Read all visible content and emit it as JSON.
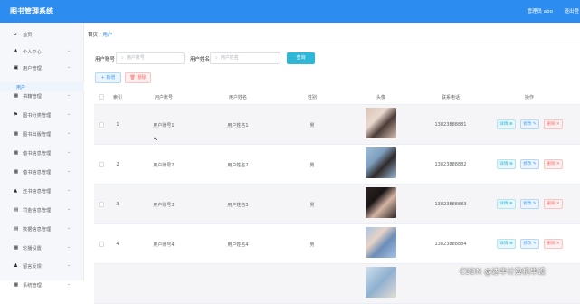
{
  "app": {
    "title": "图书管理系统",
    "user": "管理员 abo",
    "logout": "退出登"
  },
  "sidebar": {
    "items": [
      {
        "label": "首页",
        "icon": "home-icon",
        "glyph": "⌂"
      },
      {
        "label": "个人中心",
        "icon": "user-icon",
        "glyph": "♟"
      },
      {
        "label": "用户管理",
        "icon": "users-icon",
        "glyph": "▣"
      },
      {
        "label": "书籍管理",
        "icon": "grid-icon",
        "glyph": "▦"
      },
      {
        "label": "图书分类管理",
        "icon": "flag-icon",
        "glyph": "⚑"
      },
      {
        "label": "图书出版管理",
        "icon": "grid-icon",
        "glyph": "▦"
      },
      {
        "label": "借书信息管理",
        "icon": "grid-icon",
        "glyph": "▦"
      },
      {
        "label": "借书信息管理",
        "icon": "grid-icon",
        "glyph": "▦"
      },
      {
        "label": "还书信息管理",
        "icon": "lock-icon",
        "glyph": "▲"
      },
      {
        "label": "罚金信息管理",
        "icon": "doc-icon",
        "glyph": "▤"
      },
      {
        "label": "数据信息管理",
        "icon": "doc-icon",
        "glyph": "▤"
      },
      {
        "label": "轮播设置",
        "icon": "grid-icon",
        "glyph": "▦"
      },
      {
        "label": "留言反馈",
        "icon": "person-icon",
        "glyph": "♟"
      },
      {
        "label": "系统管理",
        "icon": "grid-icon",
        "glyph": "▦"
      }
    ],
    "sub": "用户"
  },
  "breadcrumb": {
    "home": "首页",
    "sep": "/",
    "current": "用户"
  },
  "search": {
    "account_label": "用户账号",
    "account_placeholder": "用户账号",
    "name_label": "用户姓名",
    "name_placeholder": "用户姓名",
    "button": "查询"
  },
  "actions": {
    "add": "+ 新增",
    "delete": "删除"
  },
  "table": {
    "headers": [
      "索引",
      "用户账号",
      "用户姓名",
      "性别",
      "头像",
      "联系电话",
      "操作"
    ],
    "rows": [
      {
        "index": "1",
        "account": "用户账号1",
        "name": "用户姓名1",
        "gender": "男",
        "phone": "13823888881",
        "avatar_colors": [
          "#d8c2b6",
          "#4a3a36",
          "#e9d9cf"
        ]
      },
      {
        "index": "2",
        "account": "用户账号2",
        "name": "用户姓名2",
        "gender": "男",
        "phone": "13823888882",
        "avatar_colors": [
          "#9dbcd6",
          "#2f2a2a",
          "#7f9fbf"
        ]
      },
      {
        "index": "3",
        "account": "用户账号3",
        "name": "用户姓名3",
        "gender": "男",
        "phone": "13823888883",
        "avatar_colors": [
          "#2b2321",
          "#d5b5a5",
          "#1a1515"
        ]
      },
      {
        "index": "4",
        "account": "用户账号4",
        "name": "用户姓名4",
        "gender": "男",
        "phone": "13823888884",
        "avatar_colors": [
          "#a9c3e3",
          "#6b8db8",
          "#e6d3c7"
        ]
      }
    ],
    "row_actions": {
      "view": "详情",
      "edit": "修改",
      "delete": "删除"
    }
  },
  "watermark": "CSDN @达华计算机毕设",
  "colors": {
    "primary": "#2d8cf0",
    "search": "#2fb7d8",
    "danger": "#f56c6c"
  }
}
